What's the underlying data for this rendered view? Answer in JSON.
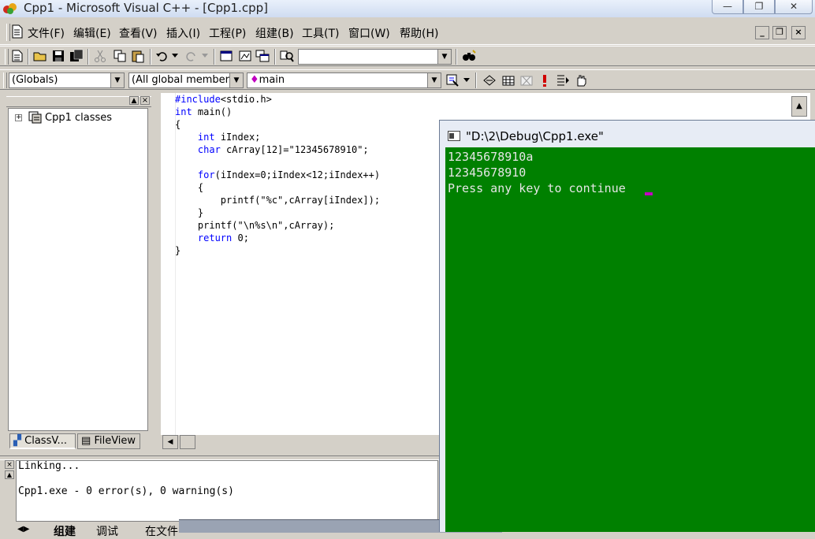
{
  "window": {
    "title": "Cpp1 - Microsoft Visual C++ - [Cpp1.cpp]",
    "minimize_glyph": "—",
    "maximize_glyph": "❐",
    "close_glyph": "✕"
  },
  "menu": [
    "文件(F)",
    "编辑(E)",
    "查看(V)",
    "插入(I)",
    "工程(P)",
    "组建(B)",
    "工具(T)",
    "窗口(W)",
    "帮助(H)"
  ],
  "mdi_buttons": {
    "minimize": "_",
    "restore": "❐",
    "close": "×"
  },
  "toolbar": {
    "find_combo_value": ""
  },
  "wizardbar": {
    "scope": "(Globals)",
    "filter": "(All global member",
    "member": "main"
  },
  "workspace": {
    "tree_root": "Cpp1 classes",
    "tabs": [
      "ClassV...",
      "FileView"
    ]
  },
  "code_lines": [
    "#include<stdio.h>",
    "int main()",
    "{",
    "    int iIndex;",
    "    char cArray[12]=\"12345678910\";",
    "",
    "    for(iIndex=0;iIndex<12;iIndex++)",
    "    {",
    "        printf(\"%c\",cArray[iIndex]);",
    "    }",
    "    printf(\"\\n%s\\n\",cArray);",
    "    return 0;",
    "}"
  ],
  "output_lines": [
    "Linking...",
    "",
    "Cpp1.exe - 0 error(s), 0 warning(s)"
  ],
  "output_tabs": [
    "组建",
    "调试",
    "在文件"
  ],
  "console": {
    "title": "\"D:\\2\\Debug\\Cpp1.exe\"",
    "lines": [
      "12345678910a",
      "12345678910",
      "Press any key to continue"
    ],
    "bg": "#008000"
  }
}
